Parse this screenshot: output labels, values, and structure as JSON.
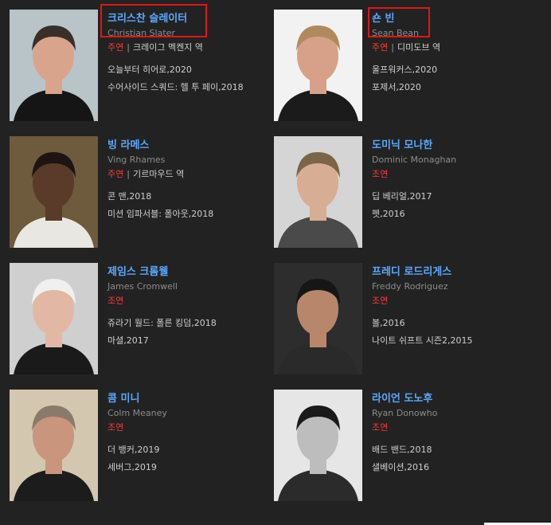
{
  "cast": [
    {
      "korean_name": "크리스찬 슬레이터",
      "english_name": "Christian Slater",
      "role": "주연",
      "separator": "|",
      "character": "크레이그 멕켄지 역",
      "works": [
        "오늘부터 히어로,2020",
        "수어사이드 스쿼드: 헬 투 페이,2018"
      ],
      "photo_bg": "#b9c4c8",
      "skin": "#d9a48c",
      "hair": "#3a2f28",
      "suit": "#151515"
    },
    {
      "korean_name": "숀 빈",
      "english_name": "Sean Bean",
      "role": "주연",
      "separator": "|",
      "character": "디미도브 역",
      "works": [
        "울프워커스,2020",
        "포제서,2020"
      ],
      "photo_bg": "#f2f2f2",
      "skin": "#d6a188",
      "hair": "#b08a5c",
      "suit": "#1b1b1b"
    },
    {
      "korean_name": "빙 라메스",
      "english_name": "Ving Rhames",
      "role": "주연",
      "separator": "|",
      "character": "기르마우드 역",
      "works": [
        "콘 맨,2018",
        "미션 임파서블: 폴아웃,2018"
      ],
      "photo_bg": "#6e5a3c",
      "skin": "#5a3a28",
      "hair": "#1e1512",
      "suit": "#e9e7e1"
    },
    {
      "korean_name": "도미닉 모나한",
      "english_name": "Dominic Monaghan",
      "role": "조연",
      "separator": "",
      "character": "",
      "works": [
        "딥 베리얼,2017",
        "펫,2016"
      ],
      "photo_bg": "#d5d5d5",
      "skin": "#d7ad94",
      "hair": "#7a6548",
      "suit": "#4a4a4a"
    },
    {
      "korean_name": "제임스 크롬웰",
      "english_name": "James Cromwell",
      "role": "조연",
      "separator": "",
      "character": "",
      "works": [
        "쥬라기 월드: 폴른 킹덤,2018",
        "마셜,2017"
      ],
      "photo_bg": "#cfcfcf",
      "skin": "#e2b8a4",
      "hair": "#f0f0f0",
      "suit": "#1a1a1a"
    },
    {
      "korean_name": "프레디 로드리게스",
      "english_name": "Freddy Rodriguez",
      "role": "조연",
      "separator": "",
      "character": "",
      "works": [
        "볼,2016",
        "나이트 쉬프트 시즌2,2015"
      ],
      "photo_bg": "#2d2d2d",
      "skin": "#b8866a",
      "hair": "#161616",
      "suit": "#2a2a2a"
    },
    {
      "korean_name": "콤 미니",
      "english_name": "Colm Meaney",
      "role": "조연",
      "separator": "",
      "character": "",
      "works": [
        "더 뱅커,2019",
        "세버그,2019"
      ],
      "photo_bg": "#d4c7b0",
      "skin": "#c9957c",
      "hair": "#8a7a6a",
      "suit": "#1c1c1c"
    },
    {
      "korean_name": "라이언 도노후",
      "english_name": "Ryan Donowho",
      "role": "조연",
      "separator": "",
      "character": "",
      "works": [
        "배드 밴드,2018",
        "샐베이션,2016"
      ],
      "photo_bg": "#e6e6e6",
      "skin": "#bdbdbd",
      "hair": "#1a1a1a",
      "suit": "#2b2b2b"
    }
  ]
}
